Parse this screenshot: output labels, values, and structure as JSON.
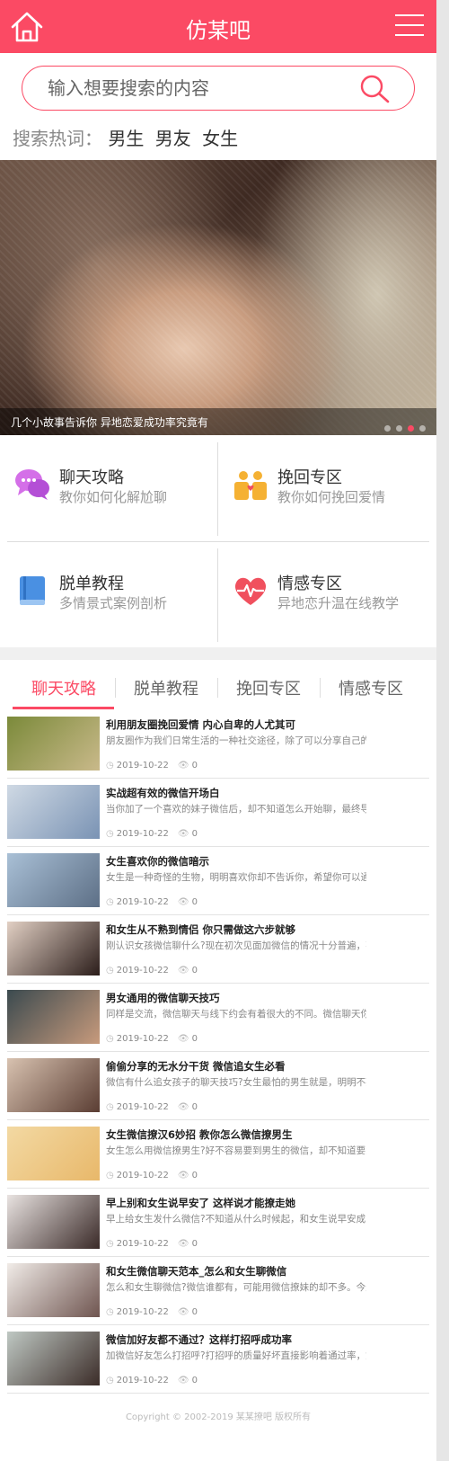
{
  "header": {
    "title": "仿某吧",
    "home_icon": "home-icon",
    "menu_icon": "hamburger-menu-icon",
    "bg_color": "#fb4a64"
  },
  "search": {
    "placeholder": "输入想要搜索的内容",
    "icon": "search-icon"
  },
  "hot": {
    "label": "搜索热词：",
    "words": [
      "男生",
      "男友",
      "女生"
    ]
  },
  "banner": {
    "caption": "几个小故事告诉你 异地恋爱成功率究竟有",
    "slides": 4,
    "active_slide": 2
  },
  "categories": [
    {
      "title": "聊天攻略",
      "subtitle": "教你如何化解尬聊",
      "icon": "chat-bubbles-icon",
      "color": "#c45ee0"
    },
    {
      "title": "挽回专区",
      "subtitle": "教你如何挽回爱情",
      "icon": "couple-icon",
      "color": "#f5b133"
    },
    {
      "title": "脱单教程",
      "subtitle": "多情景式案例剖析",
      "icon": "book-icon",
      "color": "#4a90e2"
    },
    {
      "title": "情感专区",
      "subtitle": "异地恋升温在线教学",
      "icon": "heartbeat-icon",
      "color": "#f0505e"
    }
  ],
  "tabs": [
    {
      "label": "聊天攻略",
      "active": true
    },
    {
      "label": "脱单教程",
      "active": false
    },
    {
      "label": "挽回专区",
      "active": false
    },
    {
      "label": "情感专区",
      "active": false
    }
  ],
  "articles": [
    {
      "title": "利用朋友圈挽回爱情 内心自卑的人尤其可",
      "desc": "朋友圈作为我们日常生活的一种社交途径，除了可以分享自己的...",
      "date": "2019-10-22",
      "views": "0",
      "thumb_colors": [
        "#7b8a3a",
        "#c9b98a"
      ]
    },
    {
      "title": "实战超有效的微信开场白",
      "desc": "当你加了一个喜欢的妹子微信后，却不知道怎么开始聊，最终导...",
      "date": "2019-10-22",
      "views": "0",
      "thumb_colors": [
        "#cfd9e4",
        "#7a93b4"
      ]
    },
    {
      "title": "女生喜欢你的微信暗示",
      "desc": "女生是一种奇怪的生物，明明喜欢你却不告诉你，希望你可以通...",
      "date": "2019-10-22",
      "views": "0",
      "thumb_colors": [
        "#a9c0d6",
        "#5d6f86"
      ]
    },
    {
      "title": "和女生从不熟到情侣 你只需做这六步就够",
      "desc": "刚认识女孩微信聊什么?现在初次见面加微信的情况十分普遍，不...",
      "date": "2019-10-22",
      "views": "0",
      "thumb_colors": [
        "#e2d0c4",
        "#2b1d1a"
      ]
    },
    {
      "title": "男女通用的微信聊天技巧",
      "desc": "同样是交流，微信聊天与线下约会有着很大的不同。微信聊天你...",
      "date": "2019-10-22",
      "views": "0",
      "thumb_colors": [
        "#3b4a4f",
        "#c79a7c"
      ]
    },
    {
      "title": "偷偷分享的无水分干货 微信追女生必看",
      "desc": "微信有什么追女孩子的聊天技巧?女生最怕的男生就是，明明不熟...",
      "date": "2019-10-22",
      "views": "0",
      "thumb_colors": [
        "#d8c2b0",
        "#5a3d33"
      ]
    },
    {
      "title": "女生微信撩汉6妙招 教你怎么微信撩男生",
      "desc": "女生怎么用微信撩男生?好不容易要到男生的微信，却不知道要怎...",
      "date": "2019-10-22",
      "views": "0",
      "thumb_colors": [
        "#f3d9a3",
        "#e8b86a"
      ]
    },
    {
      "title": "早上别和女生说早安了 这样说才能撩走她",
      "desc": "早上给女生发什么微信?不知道从什么时候起，和女生说早安成了...",
      "date": "2019-10-22",
      "views": "0",
      "thumb_colors": [
        "#e9e3e1",
        "#3a2a28"
      ]
    },
    {
      "title": "和女生微信聊天范本_怎么和女生聊微信",
      "desc": "怎么和女生聊微信?微信谁都有，可能用微信撩妹的却不多。今天...",
      "date": "2019-10-22",
      "views": "0",
      "thumb_colors": [
        "#f1ece8",
        "#6f5550"
      ]
    },
    {
      "title": "微信加好友都不通过？这样打招呼成功率",
      "desc": "加微信好友怎么打招呼?打招呼的质量好坏直接影响着通过率，如...",
      "date": "2019-10-22",
      "views": "0",
      "thumb_colors": [
        "#bfc8c3",
        "#3b2c28"
      ]
    }
  ],
  "meta_icons": {
    "date": "clock-icon",
    "views": "eye-icon"
  },
  "footer": "Copyright © 2002-2019 某某撩吧 版权所有"
}
